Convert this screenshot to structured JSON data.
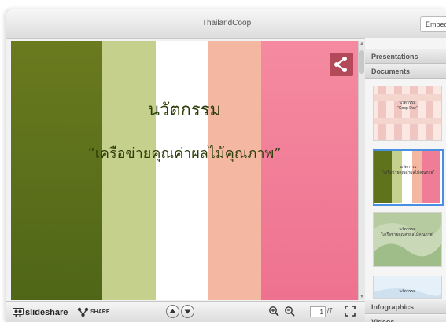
{
  "window": {
    "title": "ThailandCoop",
    "embed_label": "Embed"
  },
  "slide": {
    "title": "นวัตกรรม",
    "subtitle": "“เครือข่ายคุณค่าผลไม้คุณภาพ”",
    "stripe_colors": [
      "#5f721c",
      "#c5d08c",
      "#ffffff",
      "#f3b7a2",
      "#f07d97"
    ]
  },
  "sidebar": {
    "sections": [
      "Presentations",
      "Documents",
      "Infographics",
      "Videos"
    ],
    "thumbnails": [
      {
        "title": "นวัตกรรม",
        "subtitle": "“Coop Day”"
      },
      {
        "title": "นวัตกรรม",
        "subtitle": "“เครือข่ายคุณค่าผลไม้คุณภาพ”",
        "selected": true
      },
      {
        "title": "นวัตกรรม",
        "subtitle": "“เครือข่ายคุณค่าผลไม้คุณภาพ”"
      },
      {
        "title": "นวัตกรรม",
        "subtitle": ""
      }
    ]
  },
  "toolbar": {
    "brand": "slideshare",
    "share_label": "SHARE",
    "current_page": "1",
    "total_pages": "/7",
    "icons": [
      "share-icon",
      "previous-slide-icon",
      "next-slide-icon",
      "zoom-in-icon",
      "zoom-out-icon",
      "fullscreen-icon"
    ]
  },
  "colors": {
    "accent": "#4a90e2",
    "share_button": "#b24a5a",
    "title_text": "#2e3e0a"
  }
}
